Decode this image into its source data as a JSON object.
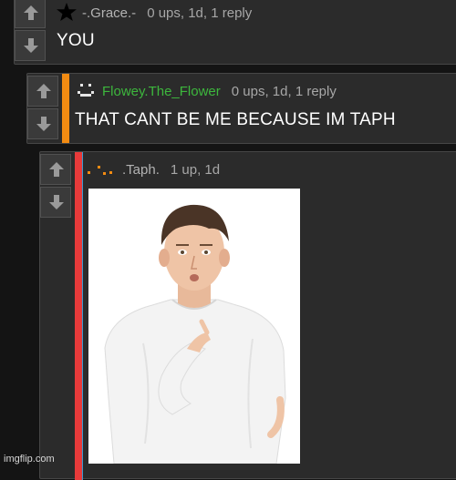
{
  "comments": [
    {
      "username": "-.Grace.-",
      "meta": "0 ups, 1d, 1 reply",
      "text": "YOU",
      "avatar_icon": "star-icon"
    },
    {
      "username": "Flowey.The_Flower",
      "meta": "0 ups, 1d, 1 reply",
      "text": "THAT CANT BE ME BECAUSE IM TAPH",
      "avatar_icon": "smiley-face-icon",
      "username_color": "#3db73d",
      "bar_color": "#f28b12"
    },
    {
      "username": ".Taph.",
      "meta": "1 up, 1d",
      "avatar_icon": "dotted-face-icon",
      "bar_color": "#e83a3a",
      "image_alt": "young man pointing at himself"
    }
  ],
  "vote": {
    "upvote_icon": "arrow-up-icon",
    "downvote_icon": "arrow-down-icon"
  },
  "watermark": "imgflip.com"
}
